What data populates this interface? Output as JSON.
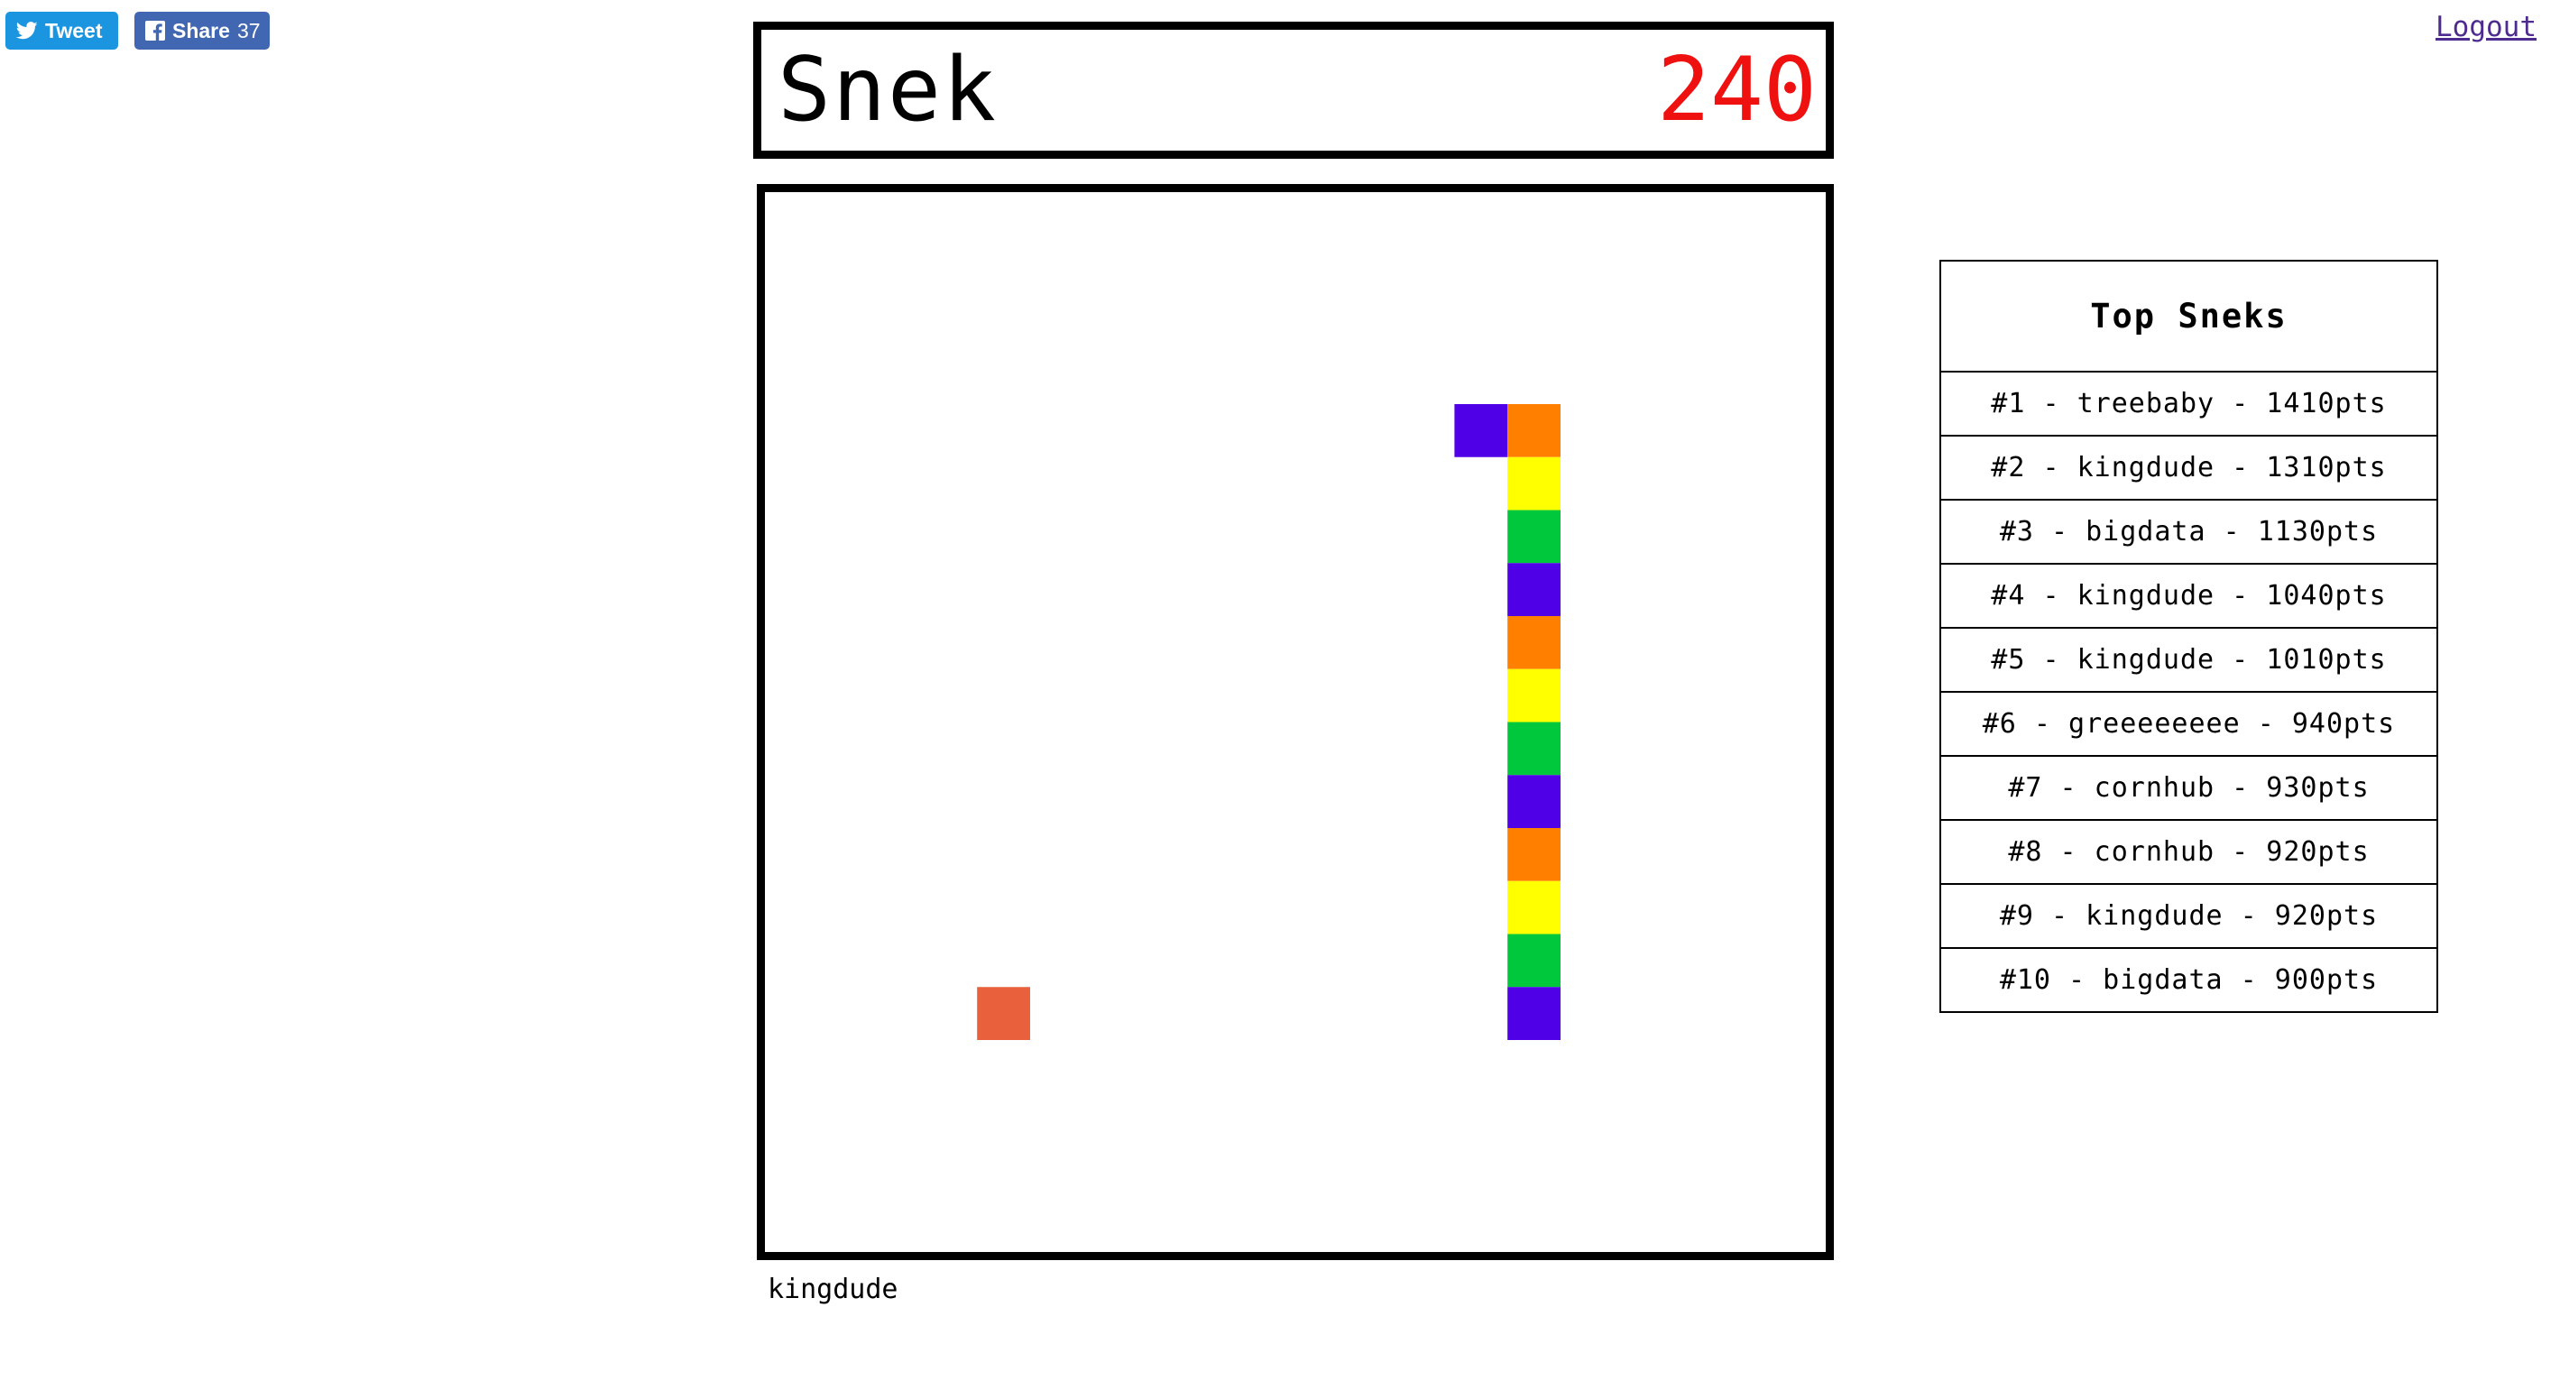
{
  "social": {
    "tweet_label": "Tweet",
    "share_label": "Share",
    "share_count": "37"
  },
  "logout_label": "Logout",
  "header": {
    "title": "Snek",
    "score": "240"
  },
  "board": {
    "grid_cols": 20,
    "grid_rows": 20,
    "food": {
      "col": 4,
      "row": 15,
      "color": "#e8603c"
    },
    "snake": [
      {
        "col": 13,
        "row": 4,
        "color": "#5000e6"
      },
      {
        "col": 14,
        "row": 4,
        "color": "#ff7f00"
      },
      {
        "col": 14,
        "row": 5,
        "color": "#ffff00"
      },
      {
        "col": 14,
        "row": 6,
        "color": "#00c83c"
      },
      {
        "col": 14,
        "row": 7,
        "color": "#5000e6"
      },
      {
        "col": 14,
        "row": 8,
        "color": "#ff7f00"
      },
      {
        "col": 14,
        "row": 9,
        "color": "#ffff00"
      },
      {
        "col": 14,
        "row": 10,
        "color": "#00c83c"
      },
      {
        "col": 14,
        "row": 11,
        "color": "#5000e6"
      },
      {
        "col": 14,
        "row": 12,
        "color": "#ff7f00"
      },
      {
        "col": 14,
        "row": 13,
        "color": "#ffff00"
      },
      {
        "col": 14,
        "row": 14,
        "color": "#00c83c"
      },
      {
        "col": 14,
        "row": 15,
        "color": "#5000e6"
      }
    ]
  },
  "player_name": "kingdude",
  "leaderboard": {
    "title": "Top Sneks",
    "entries": [
      "#1 - treebaby - 1410pts",
      "#2 - kingdude - 1310pts",
      "#3 - bigdata - 1130pts",
      "#4 - kingdude - 1040pts",
      "#5 - kingdude - 1010pts",
      "#6 - greeeeeeee - 940pts",
      "#7 - cornhub - 930pts",
      "#8 - cornhub - 920pts",
      "#9 - kingdude - 920pts",
      "#10 - bigdata - 900pts"
    ]
  },
  "colors": {
    "score": "#ef1010",
    "tweet": "#1b95e0",
    "share": "#4267b2",
    "logout": "#4d2b8f"
  }
}
